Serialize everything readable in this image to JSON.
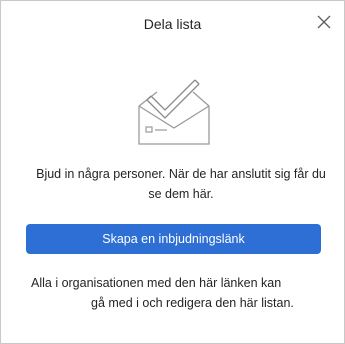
{
  "dialog": {
    "title": "Dela lista",
    "close_icon": "close-icon",
    "illustration_icon": "envelope-check-icon",
    "description": "Bjud in några personer. När de har anslutit sig får du se dem här.",
    "button_label": "Skapa en inbjudningslänk",
    "footnote_line1": "Alla i organisationen med den här länken kan",
    "footnote_line2": "gå med i och redigera den här listan.",
    "accent_color": "#2e6fd6"
  }
}
